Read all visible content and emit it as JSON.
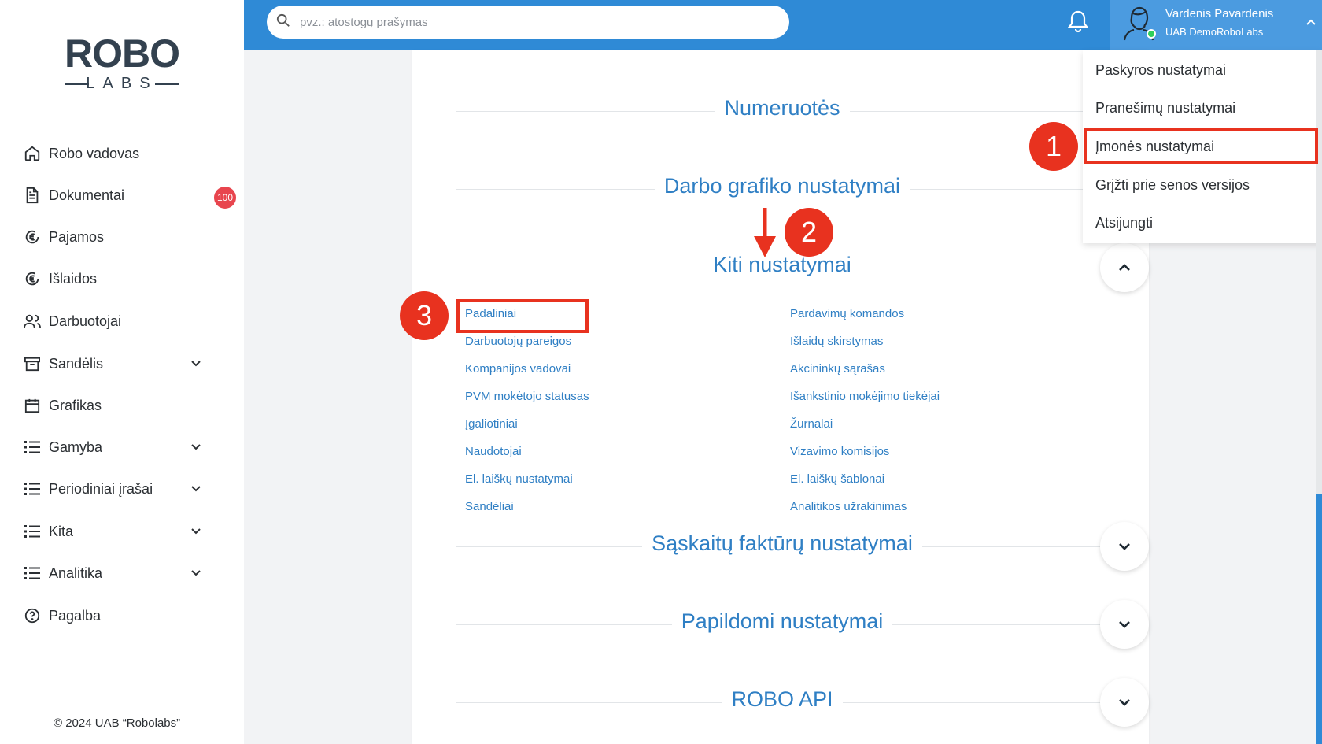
{
  "logo": {
    "word": "ROBO",
    "sub": "LABS"
  },
  "sidebar": {
    "items": [
      {
        "label": "Robo vadovas",
        "icon": "home-icon"
      },
      {
        "label": "Dokumentai",
        "icon": "document-icon",
        "badge": "100"
      },
      {
        "label": "Pajamos",
        "icon": "euro-income-icon"
      },
      {
        "label": "Išlaidos",
        "icon": "euro-expense-icon"
      },
      {
        "label": "Darbuotojai",
        "icon": "users-icon"
      },
      {
        "label": "Sandėlis",
        "icon": "archive-icon",
        "expandable": true
      },
      {
        "label": "Grafikas",
        "icon": "calendar-icon"
      },
      {
        "label": "Gamyba",
        "icon": "list-icon",
        "expandable": true
      },
      {
        "label": "Periodiniai įrašai",
        "icon": "list-icon",
        "expandable": true
      },
      {
        "label": "Kita",
        "icon": "list-icon",
        "expandable": true
      },
      {
        "label": "Analitika",
        "icon": "list-icon",
        "expandable": true
      },
      {
        "label": "Pagalba",
        "icon": "help-icon"
      }
    ],
    "copyright": "© 2024 UAB “Robolabs”"
  },
  "search": {
    "placeholder": "pvz.: atostogų prašymas"
  },
  "user": {
    "name": "Vardenis Pavardenis",
    "company": "UAB DemoRoboLabs"
  },
  "user_menu": {
    "items": [
      "Paskyros nustatymai",
      "Pranešimų nustatymai",
      "Įmonės nustatymai",
      "Grįžti prie senos versijos",
      "Atsijungti"
    ]
  },
  "sections": {
    "numeruotes": "Numeruotės",
    "darbo_grafiko": "Darbo grafiko nustatymai",
    "kiti": "Kiti nustatymai",
    "saskaitu": "Sąskaitų faktūrų nustatymai",
    "papildomi": "Papildomi nustatymai",
    "robo_api": "ROBO API"
  },
  "kiti_links": {
    "left": [
      "Padaliniai",
      "Darbuotojų pareigos",
      "Kompanijos vadovai",
      "PVM mokėtojo statusas",
      "Įgaliotiniai",
      "Naudotojai",
      "El. laiškų nustatymai",
      "Sandėliai"
    ],
    "right": [
      "Pardavimų komandos",
      "Išlaidų skirstymas",
      "Akcininkų sąrašas",
      "Išankstinio mokėjimo tiekėjai",
      "Žurnalai",
      "Vizavimo komisijos",
      "El. laiškų šablonai",
      "Analitikos užrakinimas"
    ]
  },
  "annotations": {
    "step1": "1",
    "step2": "2",
    "step3": "3"
  },
  "colors": {
    "primary": "#2f8ad6",
    "link": "#2f7fc4",
    "annotation": "#e8321f",
    "badge": "#e8454e"
  }
}
